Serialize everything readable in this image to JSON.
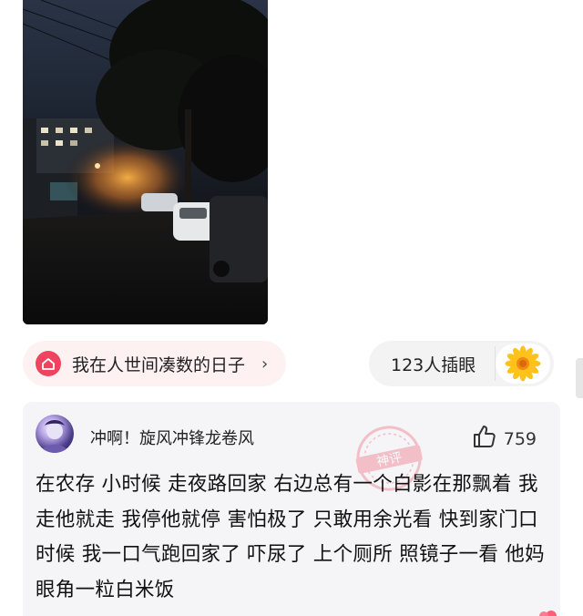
{
  "topic": {
    "label": "我在人世间凑数的日子",
    "icon": "home-icon",
    "chevron": "›",
    "accent": "#ee4460"
  },
  "reaction": {
    "label": "123人插眼",
    "icon": "sunflower-icon"
  },
  "comment": {
    "username": "冲啊！旋风冲锋龙卷风",
    "likes": "759",
    "text": "在农存 小时候 走夜路回家 右边总有一个白影在那飘着  我走他就走 我停他就停 害怕极了 只敢用余光看 快到家门口时候 我一口气跑回家了 吓尿了 上个厕所 照镜子一看 他妈 眼角一粒白米饭",
    "stamp": "神评"
  }
}
